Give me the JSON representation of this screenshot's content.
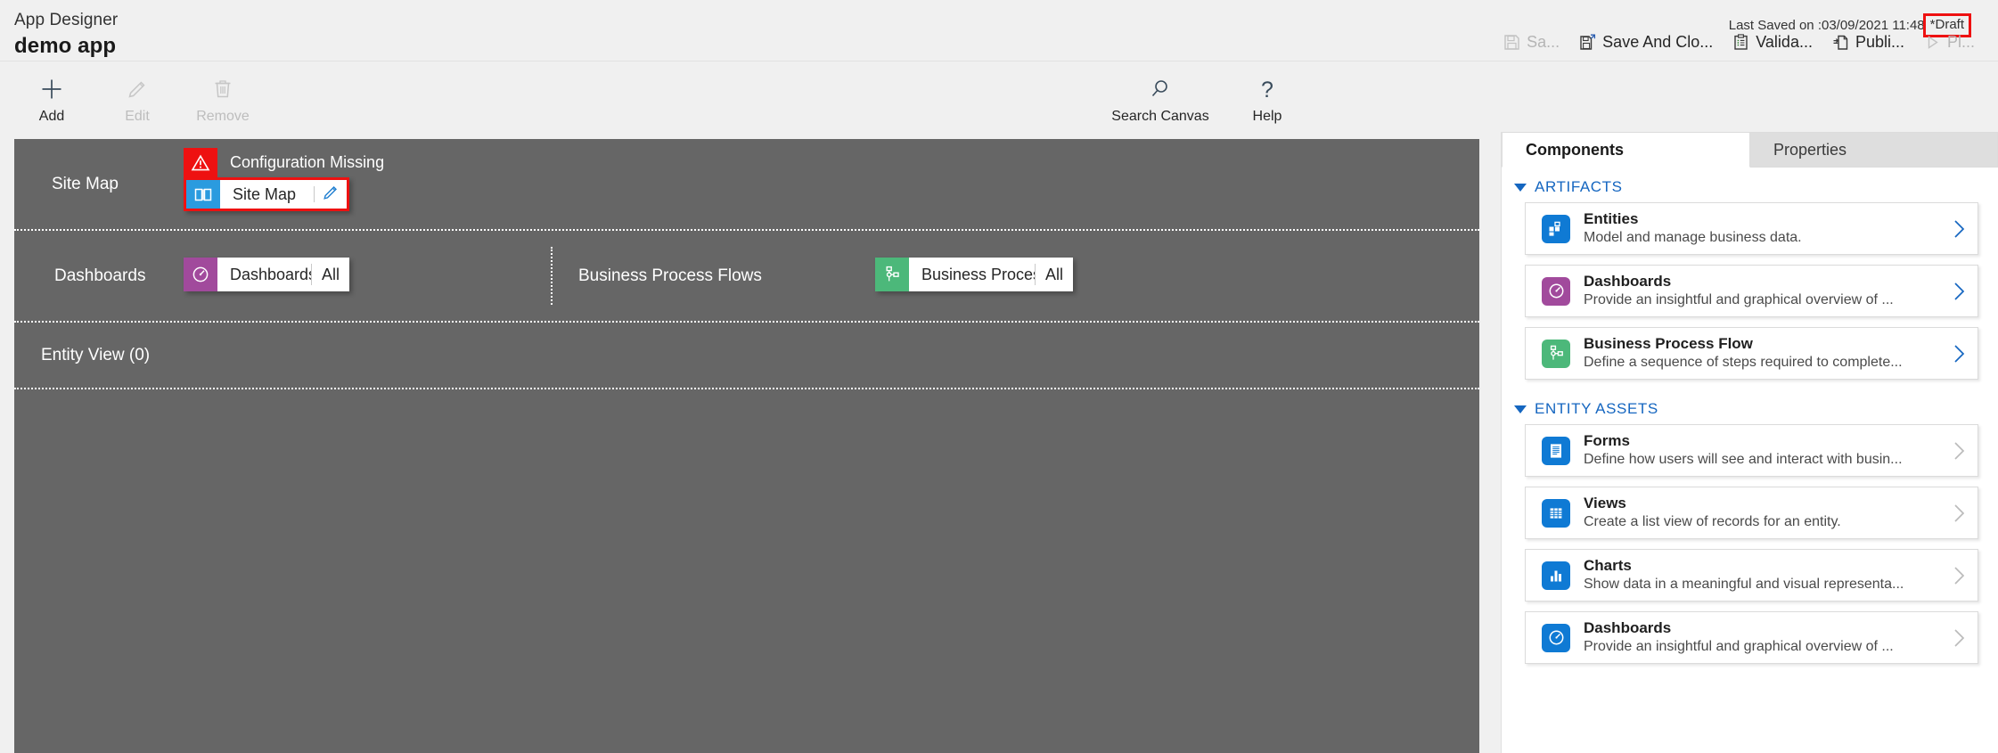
{
  "header": {
    "app_designer_label": "App Designer",
    "app_name": "demo app",
    "last_saved_text": "Last Saved on :03/09/2021 11:48",
    "draft_status": "*Draft",
    "highlight_color": "#ee1111",
    "actions": [
      {
        "label": "Sa...",
        "icon": "save-icon",
        "enabled": false
      },
      {
        "label": "Save And Clo...",
        "icon": "save-and-close-icon",
        "enabled": true
      },
      {
        "label": "Valida...",
        "icon": "validate-clipboard-icon",
        "enabled": true
      },
      {
        "label": "Publi...",
        "icon": "publish-icon",
        "enabled": true
      },
      {
        "label": "Pl...",
        "icon": "play-icon",
        "enabled": false
      }
    ]
  },
  "command_bar": {
    "left_items": [
      {
        "label": "Add",
        "icon": "plus-icon",
        "enabled": true
      },
      {
        "label": "Edit",
        "icon": "pencil-icon",
        "enabled": false
      },
      {
        "label": "Remove",
        "icon": "trash-icon",
        "enabled": false
      }
    ],
    "right_items": [
      {
        "label": "Search Canvas",
        "icon": "search-icon",
        "enabled": true
      },
      {
        "label": "Help",
        "icon": "question-mark-icon",
        "enabled": true
      }
    ]
  },
  "canvas": {
    "rows": [
      {
        "label": "Site Map",
        "warning": "Configuration Missing",
        "tile": {
          "title": "Site Map",
          "icon": "sitemap-book-icon",
          "icon_color": "#2a9bdf",
          "edit_icon": "pencil-edit-icon"
        }
      },
      {
        "label": "Dashboards",
        "tile": {
          "title": "Dashboards",
          "tail": "All",
          "icon": "dashboard-gauge-icon",
          "icon_color": "#a14a9c"
        },
        "second_label": "Business Process Flows",
        "second_tile": {
          "title": "Business Proces...",
          "tail": "All",
          "icon": "process-flow-icon",
          "icon_color": "#4cb87a"
        }
      },
      {
        "label": "Entity View (0)"
      }
    ]
  },
  "right_panel": {
    "tabs": [
      {
        "label": "Components",
        "active": true
      },
      {
        "label": "Properties",
        "active": false
      }
    ],
    "sections": [
      {
        "title": "ARTIFACTS",
        "cards": [
          {
            "title": "Entities",
            "desc": "Model and manage business data.",
            "icon": "entities-grid-icon",
            "icon_color": "#0f7ad4",
            "chevron": "chevron-right-icon",
            "chevron_color": "#1566c0"
          },
          {
            "title": "Dashboards",
            "desc": "Provide an insightful and graphical overview of ...",
            "icon": "dashboard-gauge-icon",
            "icon_color": "#a14a9c",
            "chevron": "chevron-right-icon",
            "chevron_color": "#1566c0"
          },
          {
            "title": "Business Process Flow",
            "desc": "Define a sequence of steps required to complete...",
            "icon": "process-flow-icon",
            "icon_color": "#4cb87a",
            "chevron": "chevron-right-icon",
            "chevron_color": "#1566c0"
          }
        ]
      },
      {
        "title": "ENTITY ASSETS",
        "cards": [
          {
            "title": "Forms",
            "desc": "Define how users will see and interact with busin...",
            "icon": "forms-icon",
            "icon_color": "#0f7ad4",
            "chevron": "chevron-right-icon",
            "chevron_color": "#bbbbbb"
          },
          {
            "title": "Views",
            "desc": "Create a list view of records for an entity.",
            "icon": "views-grid-icon",
            "icon_color": "#0f7ad4",
            "chevron": "chevron-right-icon",
            "chevron_color": "#bbbbbb"
          },
          {
            "title": "Charts",
            "desc": "Show data in a meaningful and visual representa...",
            "icon": "charts-bar-icon",
            "icon_color": "#0f7ad4",
            "chevron": "chevron-right-icon",
            "chevron_color": "#bbbbbb"
          },
          {
            "title": "Dashboards",
            "desc": "Provide an insightful and graphical overview of ...",
            "icon": "dashboard-gauge-icon",
            "icon_color": "#0f7ad4",
            "chevron": "chevron-right-icon",
            "chevron_color": "#bbbbbb"
          }
        ]
      }
    ]
  }
}
